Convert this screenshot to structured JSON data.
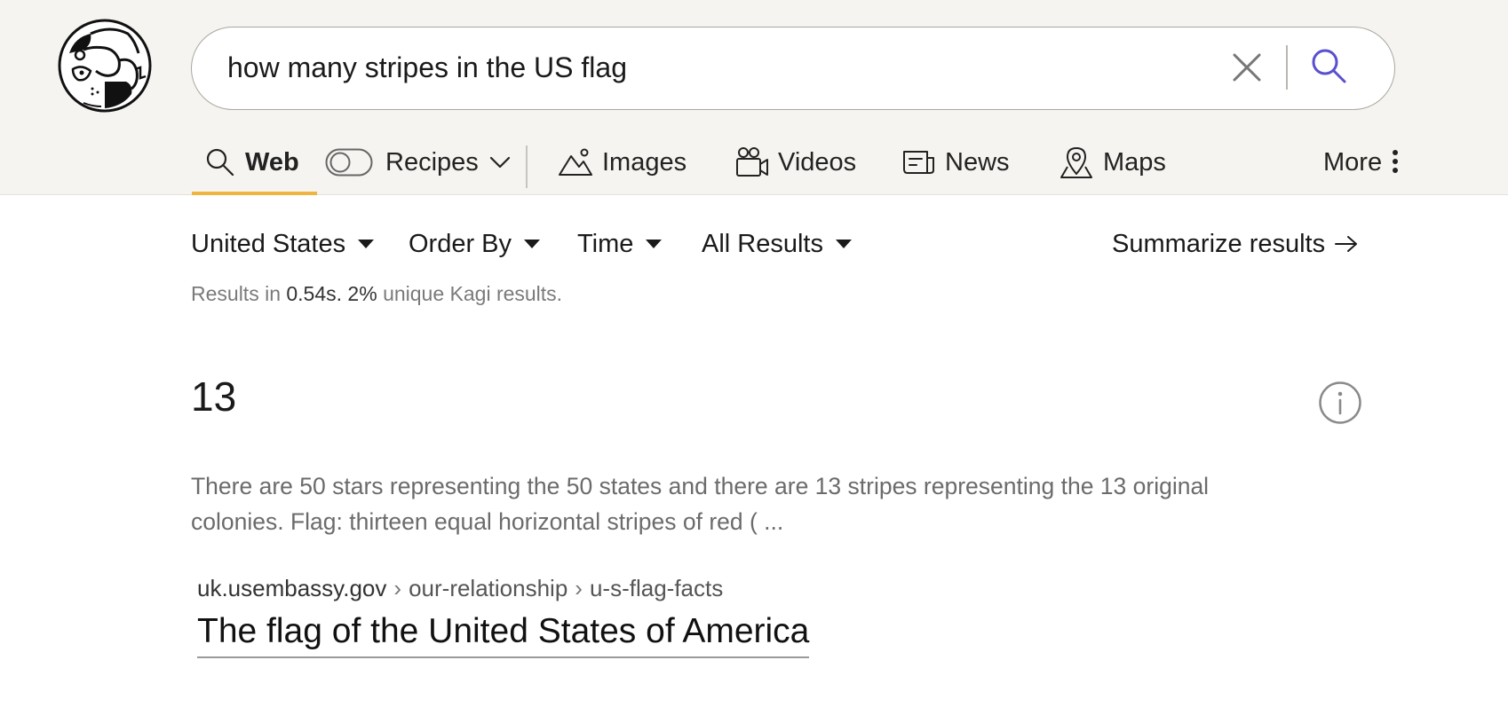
{
  "search": {
    "query": "how many stripes in the US flag"
  },
  "nav": {
    "web": "Web",
    "recipes": "Recipes",
    "images": "Images",
    "videos": "Videos",
    "news": "News",
    "maps": "Maps",
    "more": "More"
  },
  "filters": {
    "region": "United States",
    "order_by": "Order By",
    "time": "Time",
    "results": "All Results",
    "summarize": "Summarize results"
  },
  "stats": {
    "prefix": "Results in",
    "time": "0.54s.",
    "unique_pct": "2%",
    "suffix": "unique Kagi results."
  },
  "answer": {
    "value": "13",
    "snippet": "There are 50 stars representing the 50 states and there are 13 stripes representing the 13 original colonies. Flag: thirteen equal horizontal stripes of red ( ...",
    "url_domain": "uk.usembassy.gov",
    "url_path1": "our-relationship",
    "url_path2": "u-s-flag-facts",
    "url_separator": "›",
    "title": "The flag of the United States of America"
  },
  "colors": {
    "header_bg": "#f5f4f0",
    "accent_underline": "#f0b540",
    "search_icon": "#5a4fcf"
  },
  "icons": {
    "logo": "kagi-doggo-logo",
    "clear": "close-icon",
    "search": "search-icon",
    "recipes_toggle": "toggle-off-icon",
    "images": "mountain-icon",
    "videos": "video-camera-icon",
    "news": "newspaper-icon",
    "maps": "map-pin-icon",
    "more": "vertical-dots-icon",
    "info": "info-icon"
  }
}
